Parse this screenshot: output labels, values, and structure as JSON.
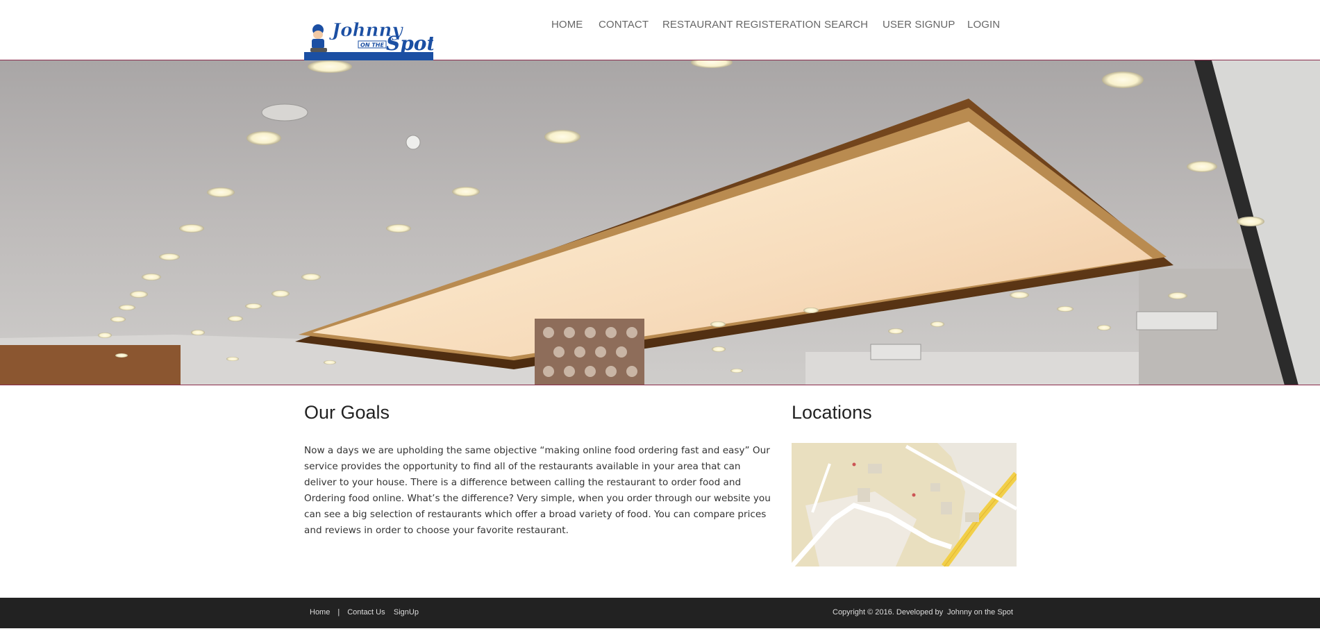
{
  "brand": {
    "logo_line1": "Johnny",
    "logo_line2": "ON THE",
    "logo_line3": "Spot",
    "logo_colors": {
      "blue": "#1b4fa3",
      "white": "#ffffff"
    }
  },
  "nav": {
    "items": [
      {
        "label": "HOME"
      },
      {
        "label": "CONTACT"
      },
      {
        "label": "RESTAURANT REGISTERATION"
      },
      {
        "label": "SEARCH"
      },
      {
        "label": "USER SIGNUP"
      },
      {
        "label": "LOGIN"
      }
    ]
  },
  "hero": {
    "description_icon": "restaurant-ceiling-photo"
  },
  "goals": {
    "title": "Our Goals",
    "body": "Now a days we are upholding the same objective “making online food ordering fast and easy” Our service provides the opportunity to find all of the restaurants available in your area that can deliver to your house. There is a difference between calling the restaurant to order food and Ordering food online. What’s the difference? Very simple, when you order through our website you can see a big selection of restaurants which offer a broad variety of food. You can compare prices and reviews in order to choose your favorite restaurant."
  },
  "locations": {
    "title": "Locations",
    "map_icon": "map-icon"
  },
  "footer": {
    "links": [
      {
        "label": "Home"
      },
      {
        "label": "Contact Us"
      },
      {
        "label": "SignUp"
      }
    ],
    "separator": "|",
    "copyright": "Copyright © 2016. Developed by",
    "developer": "Johnny on the Spot"
  },
  "colors": {
    "accent_line": "#8a2a4a",
    "footer_bg": "#222222",
    "nav_text": "#666666"
  }
}
